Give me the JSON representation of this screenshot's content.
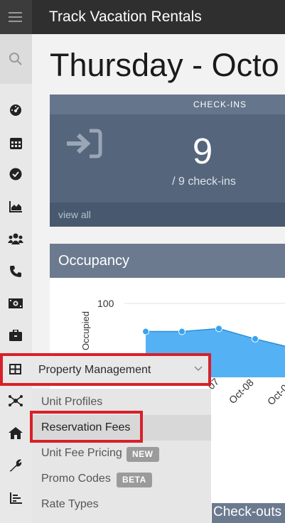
{
  "header": {
    "title": "Track Vacation Rentals"
  },
  "page": {
    "heading": "Thursday - Octo"
  },
  "checkins": {
    "title": "CHECK-INS",
    "count": "9",
    "sub": "/ 9 check-ins",
    "view_all": "view all"
  },
  "occupancy": {
    "title": "Occupancy",
    "chart_data": {
      "type": "area",
      "ylabel": "Occupied",
      "y_ticks": [
        "100"
      ],
      "x_tick_labels": [
        "07",
        "Oct-08",
        "Oct-0"
      ],
      "values": [
        62,
        62,
        66,
        52,
        40
      ]
    }
  },
  "checkouts": {
    "title": "Check-outs"
  },
  "sidebar": {
    "property_management": "Property Management",
    "submenu": [
      {
        "label": "Unit Profiles"
      },
      {
        "label": "Reservation Fees"
      },
      {
        "label": "Unit Fee Pricing",
        "badge": "NEW"
      },
      {
        "label": "Promo Codes",
        "badge": "BETA"
      },
      {
        "label": "Rate Types"
      }
    ]
  },
  "colors": {
    "accent_red": "#d8202a",
    "card_slate": "#55657c",
    "chart_blue": "#36a3f2"
  }
}
